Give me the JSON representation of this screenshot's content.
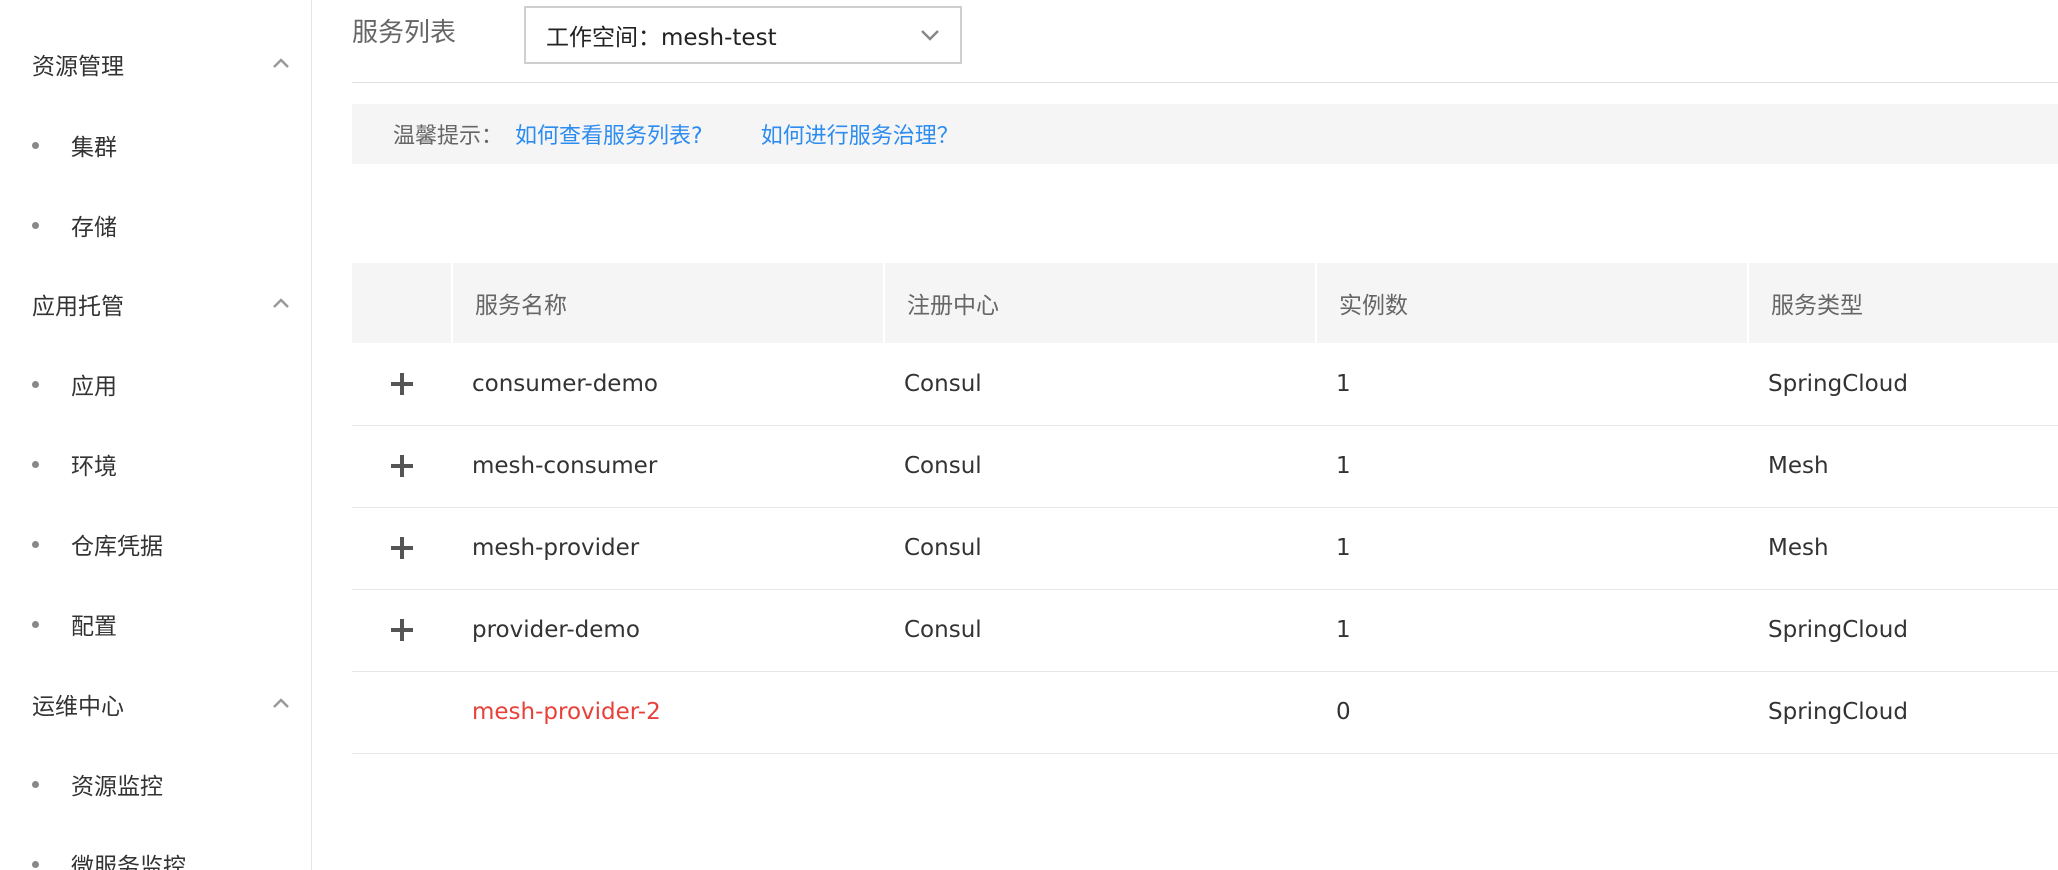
{
  "sidebar": {
    "groups": [
      {
        "label": "资源管理",
        "items": [
          {
            "label": "集群"
          },
          {
            "label": "存储"
          }
        ]
      },
      {
        "label": "应用托管",
        "items": [
          {
            "label": "应用"
          },
          {
            "label": "环境"
          },
          {
            "label": "仓库凭据"
          },
          {
            "label": "配置"
          }
        ]
      },
      {
        "label": "运维中心",
        "items": [
          {
            "label": "资源监控"
          },
          {
            "label": "微服务监控"
          }
        ]
      }
    ]
  },
  "header": {
    "title": "服务列表",
    "workspace_select": {
      "value": "工作空间：mesh-test"
    }
  },
  "tips": {
    "label": "温馨提示：",
    "links": [
      "如何查看服务列表?",
      "如何进行服务治理？"
    ]
  },
  "table": {
    "columns": [
      "",
      "服务名称",
      "注册中心",
      "实例数",
      "服务类型"
    ],
    "rows": [
      {
        "name": "consumer-demo",
        "registry": "Consul",
        "instances": "1",
        "type": "SpringCloud"
      },
      {
        "name": "mesh-consumer",
        "registry": "Consul",
        "instances": "1",
        "type": "Mesh"
      },
      {
        "name": "mesh-provider",
        "registry": "Consul",
        "instances": "1",
        "type": "Mesh"
      },
      {
        "name": "provider-demo",
        "registry": "Consul",
        "instances": "1",
        "type": "SpringCloud"
      },
      {
        "name": "mesh-provider-2",
        "registry": "",
        "instances": "0",
        "type": "SpringCloud"
      }
    ]
  },
  "colors": {
    "link": "#2d8cf0",
    "error_text": "#e7413a",
    "header_bg": "#f5f5f5"
  },
  "icons": {
    "group_toggle": "chevron-up-icon",
    "dropdown": "chevron-down-icon",
    "row_expand": "plus-icon"
  }
}
